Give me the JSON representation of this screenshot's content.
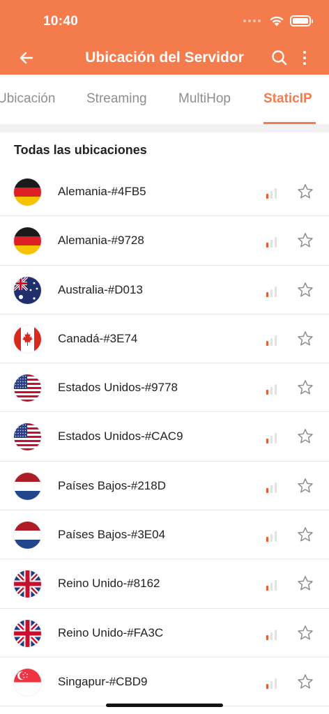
{
  "status_bar": {
    "time": "10:40"
  },
  "header": {
    "title": "Ubicación del Servidor",
    "back_icon": "back-arrow-icon",
    "search_icon": "search-icon",
    "more_icon": "more-vertical-icon",
    "accent_color": "#f47c4c"
  },
  "tabs": [
    {
      "label": "Ubicación",
      "active": false
    },
    {
      "label": "Streaming",
      "active": false
    },
    {
      "label": "MultiHop",
      "active": false
    },
    {
      "label": "StaticIP",
      "active": true
    }
  ],
  "section_title": "Todas las ubicaciones",
  "locations": [
    {
      "name": "Alemania-#4FB5",
      "flag": "germany"
    },
    {
      "name": "Alemania-#9728",
      "flag": "germany"
    },
    {
      "name": "Australia-#D013",
      "flag": "australia"
    },
    {
      "name": "Canadá-#3E74",
      "flag": "canada"
    },
    {
      "name": "Estados Unidos-#9778",
      "flag": "usa"
    },
    {
      "name": "Estados Unidos-#CAC9",
      "flag": "usa"
    },
    {
      "name": "Países Bajos-#218D",
      "flag": "netherlands"
    },
    {
      "name": "Países Bajos-#3E04",
      "flag": "netherlands"
    },
    {
      "name": "Reino Unido-#8162",
      "flag": "uk"
    },
    {
      "name": "Reino Unido-#FA3C",
      "flag": "uk"
    },
    {
      "name": "Singapur-#CBD9",
      "flag": "singapore"
    }
  ],
  "signal_icon": "signal-strength-icon",
  "favorite_icon": "star-outline-icon"
}
